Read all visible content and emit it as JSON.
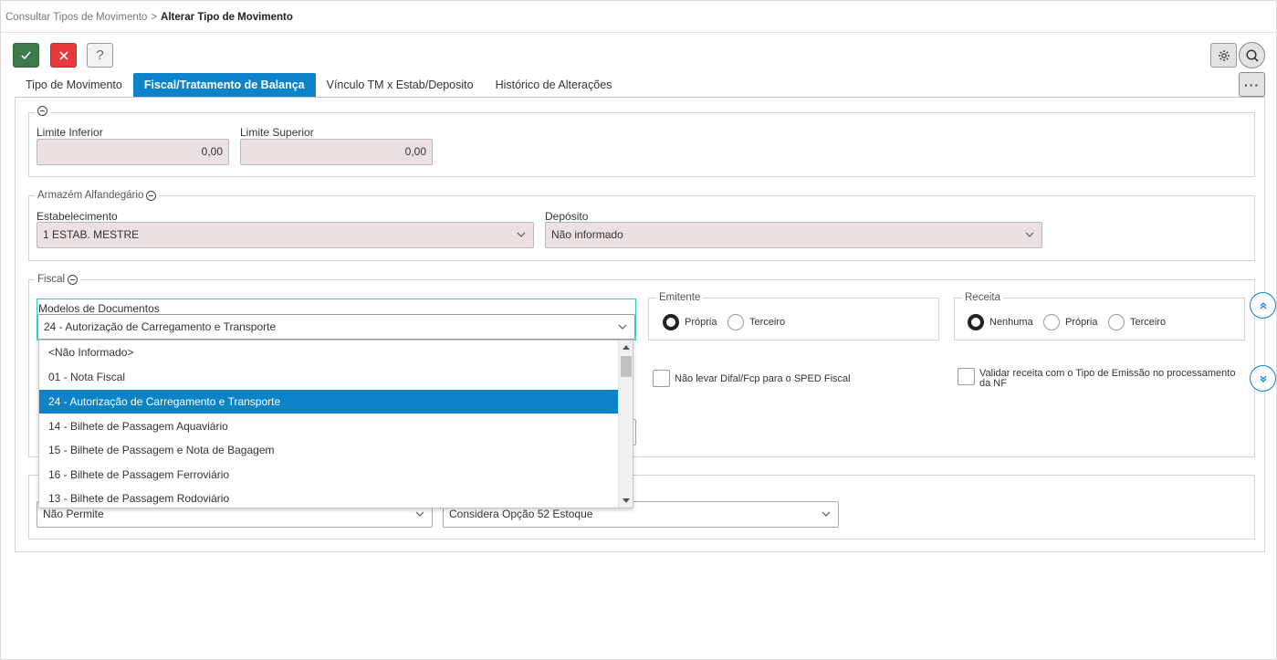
{
  "breadcrumb": {
    "parent": "Consultar Tipos de Movimento",
    "separator": ">",
    "current": "Alterar Tipo de Movimento"
  },
  "toolbar": {
    "confirm_icon": "check-icon",
    "cancel_icon": "close-icon",
    "help_label": "?",
    "settings_icon": "gear-icon",
    "search_icon": "search-icon",
    "more_label": "···"
  },
  "tabs": [
    {
      "label": "Tipo de Movimento",
      "active": false
    },
    {
      "label": "Fiscal/Tratamento de Balança",
      "active": true
    },
    {
      "label": "Vínculo TM x Estab/Deposito",
      "active": false
    },
    {
      "label": "Histórico de Alterações",
      "active": false
    }
  ],
  "limits": {
    "lower_label": "Limite Inferior",
    "lower_value": "0,00",
    "upper_label": "Limite Superior",
    "upper_value": "0,00"
  },
  "armazem": {
    "legend": "Armazém Alfandegário",
    "estabelecimento_label": "Estabelecimento",
    "estabelecimento_value": "1 ESTAB. MESTRE",
    "deposito_label": "Depósito",
    "deposito_value": "Não informado"
  },
  "fiscal": {
    "legend": "Fiscal",
    "modelos_label": "Modelos de Documentos",
    "modelos_value": "24 - Autorização de Carregamento e Transporte",
    "options": [
      "<Não Informado>",
      "01 - Nota Fiscal",
      "24 - Autorização de Carregamento e Transporte",
      "14 - Bilhete de Passagem Aquaviário",
      "15 - Bilhete de Passagem e Nota de Bagagem",
      "16 - Bilhete de Passagem Ferroviário",
      "13 - Bilhete de Passagem Rodoviário"
    ],
    "emitente": {
      "legend": "Emitente",
      "options": [
        "Própria",
        "Terceiro"
      ],
      "selected": "Própria"
    },
    "receita": {
      "legend": "Receita",
      "options": [
        "Nenhuma",
        "Própria",
        "Terceiro"
      ],
      "selected": "Nenhuma"
    },
    "chk_difal": "Não levar Difal/Fcp para o SPED Fiscal",
    "chk_validar": "Validar receita com o Tipo de Emissão no processamento da NF"
  },
  "bottom": {
    "select1_value": "Não Permite",
    "select2_value": "Considera Opção 52 Estoque"
  },
  "colors": {
    "accent": "#0b83c6",
    "confirm": "#3c7a4b",
    "cancel": "#e5393c",
    "field_bg": "#ebe1e1",
    "focus": "#33d1b4"
  }
}
